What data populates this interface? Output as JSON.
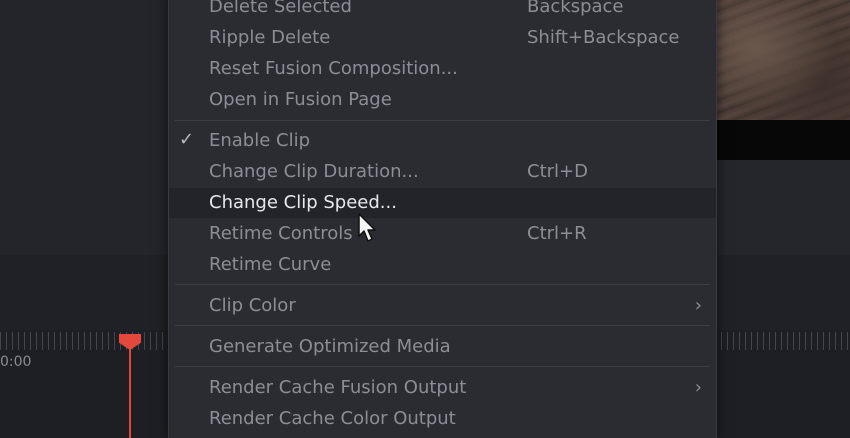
{
  "menu": {
    "items": [
      {
        "label": "Delete Selected",
        "shortcut": "Backspace"
      },
      {
        "label": "Ripple Delete",
        "shortcut": "Shift+Backspace"
      },
      {
        "label": "Reset Fusion Composition...",
        "shortcut": ""
      },
      {
        "label": "Open in Fusion Page",
        "shortcut": ""
      },
      {
        "label": "Enable Clip",
        "shortcut": "",
        "checked": true
      },
      {
        "label": "Change Clip Duration...",
        "shortcut": "Ctrl+D"
      },
      {
        "label": "Change Clip Speed...",
        "shortcut": "",
        "highlighted": true
      },
      {
        "label": "Retime Controls",
        "shortcut": "Ctrl+R"
      },
      {
        "label": "Retime Curve",
        "shortcut": ""
      },
      {
        "label": "Clip Color",
        "shortcut": "",
        "submenu": true
      },
      {
        "label": "Generate Optimized Media",
        "shortcut": ""
      },
      {
        "label": "Render Cache Fusion Output",
        "shortcut": "",
        "submenu": true
      },
      {
        "label": "Render Cache Color Output",
        "shortcut": ""
      }
    ],
    "check_glyph": "✓",
    "submenu_glyph": "›"
  },
  "timeline": {
    "timecode": "0:00",
    "playhead_color": "#e2483c"
  },
  "colors": {
    "menu_bg": "#2b2c32",
    "menu_text": "#8d8e95",
    "highlight_text": "#e8e8ec"
  }
}
